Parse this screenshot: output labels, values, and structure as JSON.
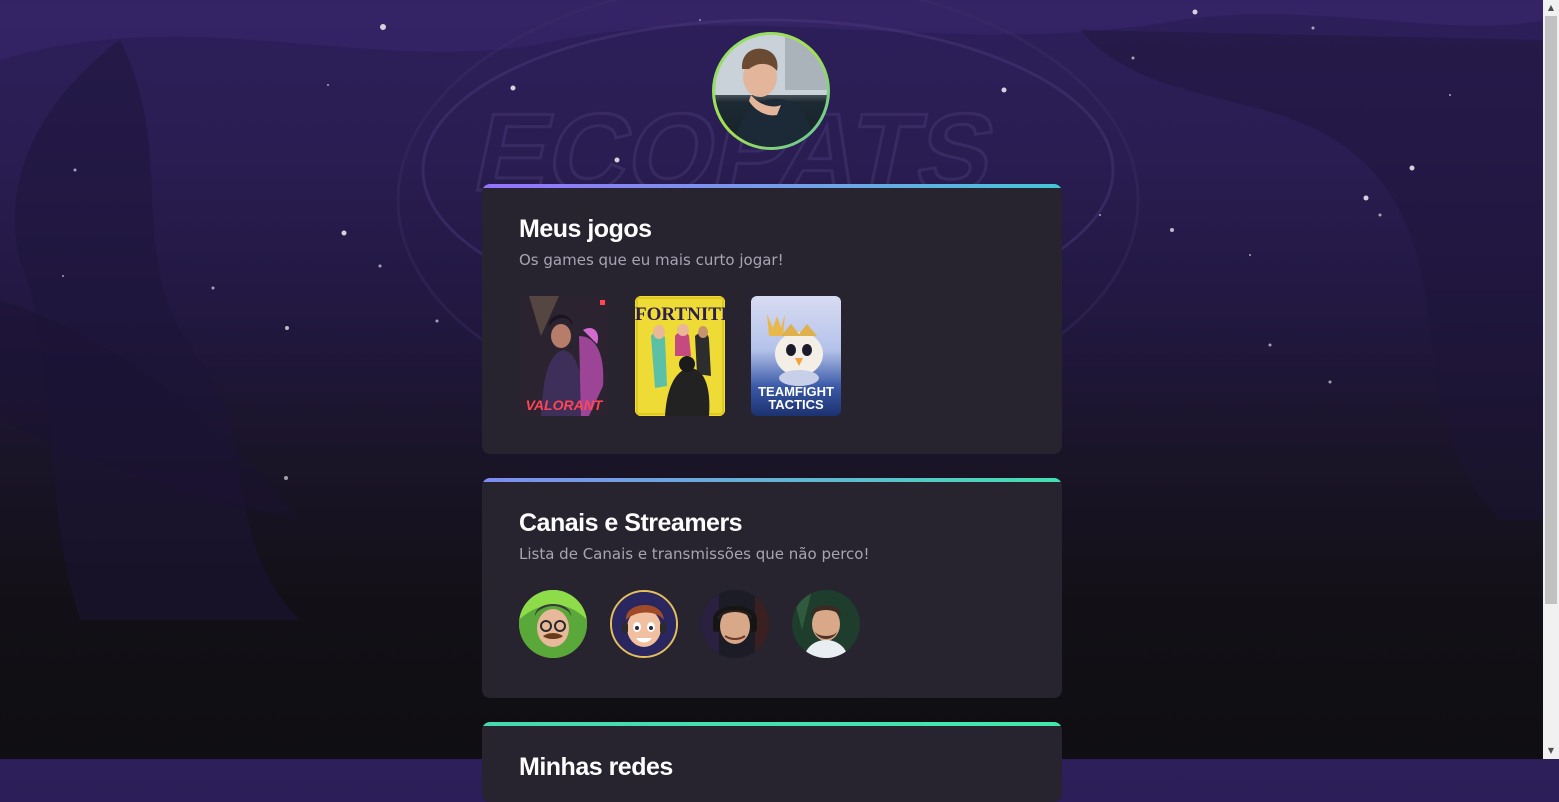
{
  "profile": {
    "avatar_alt": "Foto de perfil"
  },
  "cards": {
    "games": {
      "title": "Meus jogos",
      "subtitle": "Os games que eu mais curto jogar!",
      "items": [
        {
          "name": "VALORANT",
          "icon": "valorant-cover"
        },
        {
          "name": "FORTNITE",
          "icon": "fortnite-cover"
        },
        {
          "name": "TEAMFIGHT TACTICS",
          "line1": "TEAMFIGHT",
          "line2": "TACTICS",
          "icon": "tft-cover"
        }
      ]
    },
    "streamers": {
      "title": "Canais e Streamers",
      "subtitle": "Lista de Canais e transmissões que não perco!",
      "items": [
        {
          "icon": "streamer-avatar-1"
        },
        {
          "icon": "streamer-avatar-2"
        },
        {
          "icon": "streamer-avatar-3"
        },
        {
          "icon": "streamer-avatar-4"
        }
      ]
    },
    "third": {
      "title": "Minhas redes"
    }
  },
  "colors": {
    "card_bg": "#27232f",
    "title": "#ffffff",
    "subtitle": "#a8a5b3",
    "accent_purple": "#9572fc",
    "accent_teal": "#43e7ad"
  }
}
